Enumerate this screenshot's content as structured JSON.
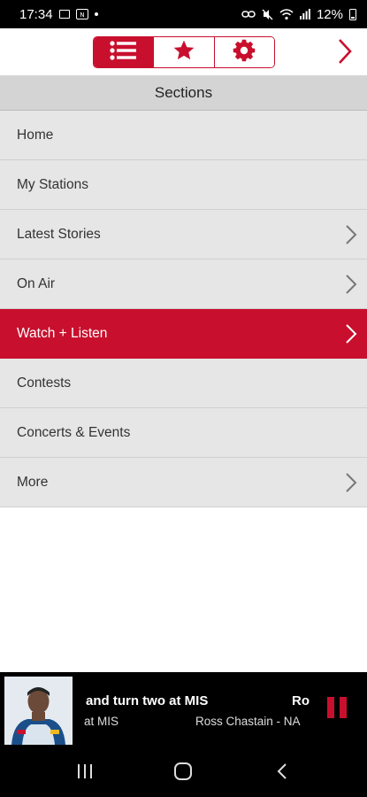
{
  "status_bar": {
    "time": "17:34",
    "battery": "12%",
    "icons": [
      "image-icon",
      "nfc-icon",
      "notification-dot",
      "link-icon",
      "mute-icon",
      "wifi-icon",
      "signal-icon",
      "battery-icon"
    ]
  },
  "toolbar": {
    "tabs": [
      {
        "name": "list-icon",
        "active": true
      },
      {
        "name": "star-icon",
        "active": false
      },
      {
        "name": "gear-icon",
        "active": false
      }
    ],
    "next_icon": "chevron-right-icon"
  },
  "sections_title": "Sections",
  "menu": [
    {
      "label": "Home",
      "has_chevron": false,
      "active": false
    },
    {
      "label": "My Stations",
      "has_chevron": false,
      "active": false
    },
    {
      "label": "Latest Stories",
      "has_chevron": true,
      "active": false
    },
    {
      "label": "On Air",
      "has_chevron": true,
      "active": false
    },
    {
      "label": "Watch + Listen",
      "has_chevron": true,
      "active": true
    },
    {
      "label": "Contests",
      "has_chevron": false,
      "active": false
    },
    {
      "label": "Concerts & Events",
      "has_chevron": false,
      "active": false
    },
    {
      "label": "More",
      "has_chevron": true,
      "active": false
    }
  ],
  "player": {
    "title": "and turn two at MIS",
    "title_next": "Ro",
    "subtitle": "at MIS",
    "subtitle_next": "Ross Chastain - NA",
    "pause_icon": "pause-icon"
  },
  "colors": {
    "accent": "#c8102e",
    "menu_bg": "#e6e6e6",
    "header_bg": "#d4d4d4"
  }
}
